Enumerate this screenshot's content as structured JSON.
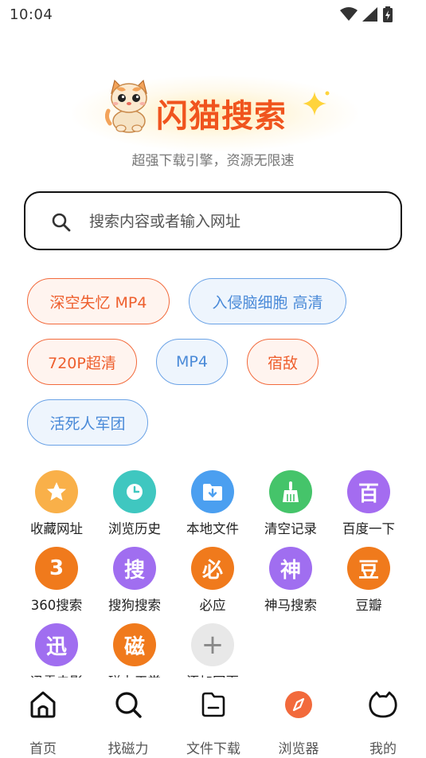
{
  "status_bar": {
    "time": "10:04"
  },
  "logo": {
    "title": "闪猫搜索",
    "subtitle": "超强下载引擎，资源无限速"
  },
  "search": {
    "placeholder": "搜索内容或者输入网址",
    "value": ""
  },
  "tags": [
    {
      "label": "深空失忆 MP4",
      "style": "orange"
    },
    {
      "label": "入侵脑细胞 高清",
      "style": "blue"
    },
    {
      "label": "720P超清",
      "style": "orange"
    },
    {
      "label": "MP4",
      "style": "blue"
    },
    {
      "label": "宿敌",
      "style": "orange"
    },
    {
      "label": "活死人军团",
      "style": "blue"
    }
  ],
  "shortcuts": [
    {
      "label": "收藏网址",
      "icon": "star-icon",
      "color": "#f9b049",
      "glyph": ""
    },
    {
      "label": "浏览历史",
      "icon": "clock-icon",
      "color": "#3fc7c0",
      "glyph": ""
    },
    {
      "label": "本地文件",
      "icon": "folder-download-icon",
      "color": "#4b9ff0",
      "glyph": ""
    },
    {
      "label": "清空记录",
      "icon": "broom-icon",
      "color": "#45c46a",
      "glyph": ""
    },
    {
      "label": "百度一下",
      "icon": "baidu-icon",
      "color": "#a46cf0",
      "glyph": "百"
    },
    {
      "label": "360搜索",
      "icon": "search360-icon",
      "color": "#f07a1c",
      "glyph": "3"
    },
    {
      "label": "搜狗搜索",
      "icon": "sogou-icon",
      "color": "#a06ef0",
      "glyph": "搜"
    },
    {
      "label": "必应",
      "icon": "bing-icon",
      "color": "#f07a1c",
      "glyph": "必"
    },
    {
      "label": "神马搜索",
      "icon": "shenma-icon",
      "color": "#a06ef0",
      "glyph": "神"
    },
    {
      "label": "豆瓣",
      "icon": "douban-icon",
      "color": "#f07a1c",
      "glyph": "豆"
    },
    {
      "label": "迅雷电影",
      "icon": "xunlei-icon",
      "color": "#a06ef0",
      "glyph": "迅"
    },
    {
      "label": "磁力天堂",
      "icon": "magnet-icon",
      "color": "#f07a1c",
      "glyph": "磁"
    },
    {
      "label": "添加网页",
      "icon": "plus-icon",
      "color": "#e8e8e8",
      "glyph": "+"
    }
  ],
  "nav": [
    {
      "label": "首页",
      "icon": "home-icon"
    },
    {
      "label": "找磁力",
      "icon": "search-icon"
    },
    {
      "label": "文件下载",
      "icon": "file-icon"
    },
    {
      "label": "浏览器",
      "icon": "compass-icon"
    },
    {
      "label": "我的",
      "icon": "cat-face-icon"
    }
  ],
  "colors": {
    "brand": "#f0541e",
    "tag_orange": "#ee5f2e",
    "tag_blue": "#4a8ad8"
  }
}
